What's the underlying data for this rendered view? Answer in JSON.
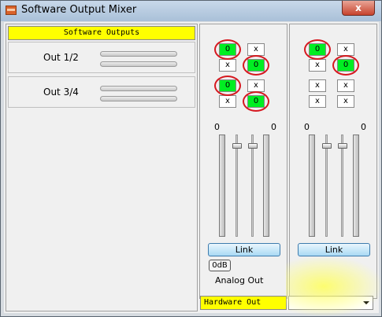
{
  "window": {
    "title": "Software Output Mixer",
    "close_glyph": "x"
  },
  "software_outputs": {
    "header": "Software Outputs",
    "rows": [
      {
        "label": "Out 1/2"
      },
      {
        "label": "Out 3/4"
      }
    ]
  },
  "mixers": [
    {
      "cells": [
        "0",
        "x",
        "x",
        "0",
        "0",
        "x",
        "x",
        "0"
      ],
      "left_value": "0",
      "right_value": "0",
      "link_label": "Link"
    },
    {
      "cells": [
        "0",
        "x",
        "x",
        "0",
        "x",
        "x",
        "x",
        "x"
      ],
      "left_value": "0",
      "right_value": "0",
      "link_label": "Link"
    }
  ],
  "db_label": "0dB",
  "analog_out_label": "Analog Out",
  "hardware_outputs_label": "Hardware Out",
  "colors": {
    "active_cell": "#00ee22",
    "highlight_ring": "#d6181f",
    "header_yellow": "#ffff00"
  }
}
